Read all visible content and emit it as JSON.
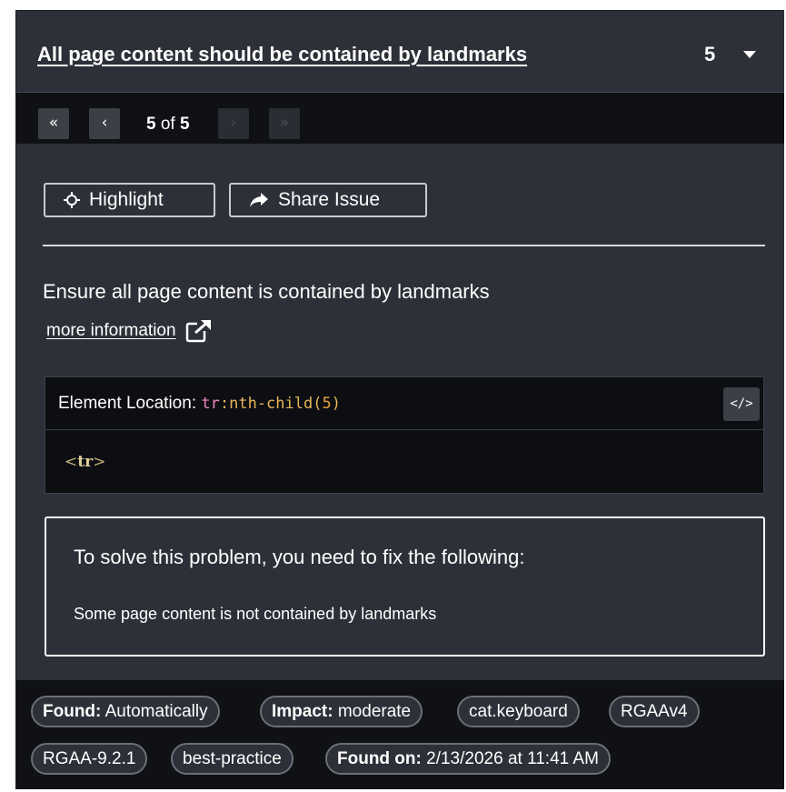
{
  "issue": {
    "title": "All page content should be contained by landmarks",
    "count": "5"
  },
  "pager": {
    "first_label": "«",
    "prev_label": "‹",
    "next_label": "›",
    "last_label": "»",
    "current": "5",
    "of_label": "of",
    "total": "5"
  },
  "actions": {
    "highlight_label": "Highlight",
    "share_label": "Share Issue"
  },
  "description": "Ensure all page content is contained by landmarks",
  "more_info_label": "more information",
  "location": {
    "label": "Element Location:",
    "selector_tag": "tr",
    "selector_pseudo": ":nth-child(",
    "selector_num": "5",
    "selector_close": ")",
    "toggle_label": "</>",
    "snippet_open": "<",
    "snippet_tag": "tr",
    "snippet_close": ">"
  },
  "fix": {
    "title": "To solve this problem, you need to fix the following:",
    "items": [
      "Some page content is not contained by landmarks"
    ]
  },
  "tags": {
    "found_label": "Found:",
    "found_value": "Automatically",
    "impact_label": "Impact:",
    "impact_value": "moderate",
    "cat": "cat.keyboard",
    "rgaa": "RGAAv4",
    "rgaa_rule": "RGAA-9.2.1",
    "best_practice": "best-practice",
    "found_on_label": "Found on:",
    "found_on_value": "2/13/2026 at 11:41 AM"
  },
  "icons": {
    "highlight": "crosshair-icon",
    "share": "share-arrow-icon",
    "external": "external-link-icon",
    "caret": "chevron-down-icon"
  }
}
